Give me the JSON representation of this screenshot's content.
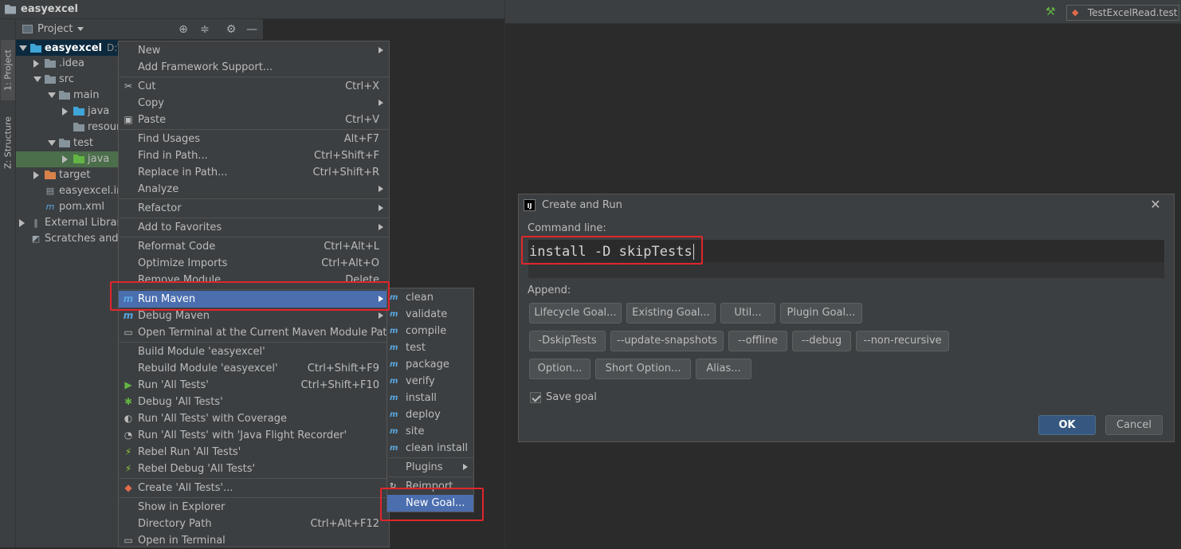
{
  "ide": {
    "project_name": "easyexcel",
    "left_tabs": [
      "1: Project",
      "Z: Structure"
    ],
    "project_dropdown": "Project",
    "tree": [
      {
        "label": "easyexcel",
        "suffix": "D:\\Id",
        "level": 0,
        "arrow": "down",
        "icon": "module"
      },
      {
        "label": ".idea",
        "level": 1,
        "arrow": "right",
        "icon": "folder-gray"
      },
      {
        "label": "src",
        "level": 1,
        "arrow": "down",
        "icon": "folder-gray"
      },
      {
        "label": "main",
        "level": 2,
        "arrow": "down",
        "icon": "folder-gray"
      },
      {
        "label": "java",
        "level": 3,
        "arrow": "right",
        "icon": "folder-blue"
      },
      {
        "label": "resour",
        "level": 3,
        "arrow": "none",
        "icon": "folder-resources"
      },
      {
        "label": "test",
        "level": 2,
        "arrow": "down",
        "icon": "folder-gray"
      },
      {
        "label": "java",
        "level": 3,
        "arrow": "right",
        "icon": "folder-green"
      },
      {
        "label": "target",
        "level": 1,
        "arrow": "right",
        "icon": "folder-orange"
      },
      {
        "label": "easyexcel.im",
        "level": 1,
        "arrow": "none",
        "icon": "iml-file"
      },
      {
        "label": "pom.xml",
        "level": 1,
        "arrow": "none",
        "icon": "maven-file"
      },
      {
        "label": "External Librari",
        "level": 0,
        "arrow": "right",
        "icon": "libraries"
      },
      {
        "label": "Scratches and C",
        "level": 0,
        "arrow": "none",
        "icon": "scratches"
      }
    ],
    "run_config": "TestExcelRead.test"
  },
  "context_menu": {
    "items": [
      {
        "label": "New",
        "shortcut": "",
        "submenu": true,
        "icon": ""
      },
      {
        "label": "Add Framework Support...",
        "shortcut": "",
        "submenu": false,
        "icon": ""
      },
      {
        "label": "Cut",
        "shortcut": "Ctrl+X",
        "submenu": false,
        "icon": "scissors"
      },
      {
        "label": "Copy",
        "shortcut": "",
        "submenu": true,
        "icon": ""
      },
      {
        "label": "Paste",
        "shortcut": "Ctrl+V",
        "submenu": false,
        "icon": "clipboard"
      },
      {
        "label": "Find Usages",
        "shortcut": "Alt+F7",
        "submenu": false,
        "icon": ""
      },
      {
        "label": "Find in Path...",
        "shortcut": "Ctrl+Shift+F",
        "submenu": false,
        "icon": ""
      },
      {
        "label": "Replace in Path...",
        "shortcut": "Ctrl+Shift+R",
        "submenu": false,
        "icon": ""
      },
      {
        "label": "Analyze",
        "shortcut": "",
        "submenu": true,
        "icon": ""
      },
      {
        "label": "Refactor",
        "shortcut": "",
        "submenu": true,
        "icon": ""
      },
      {
        "label": "Add to Favorites",
        "shortcut": "",
        "submenu": true,
        "icon": ""
      },
      {
        "label": "Reformat Code",
        "shortcut": "Ctrl+Alt+L",
        "submenu": false,
        "icon": ""
      },
      {
        "label": "Optimize Imports",
        "shortcut": "Ctrl+Alt+O",
        "submenu": false,
        "icon": ""
      },
      {
        "label": "Remove Module",
        "shortcut": "Delete",
        "submenu": false,
        "icon": ""
      },
      {
        "label": "Run Maven",
        "shortcut": "",
        "submenu": true,
        "icon": "maven",
        "highlighted": true
      },
      {
        "label": "Debug Maven",
        "shortcut": "",
        "submenu": true,
        "icon": "maven"
      },
      {
        "label": "Open Terminal at the Current Maven Module Path",
        "shortcut": "",
        "submenu": false,
        "icon": "terminal"
      },
      {
        "label": "Build Module 'easyexcel'",
        "shortcut": "",
        "submenu": false,
        "icon": ""
      },
      {
        "label": "Rebuild Module 'easyexcel'",
        "shortcut": "Ctrl+Shift+F9",
        "submenu": false,
        "icon": ""
      },
      {
        "label": "Run 'All Tests'",
        "shortcut": "Ctrl+Shift+F10",
        "submenu": false,
        "icon": "run"
      },
      {
        "label": "Debug 'All Tests'",
        "shortcut": "",
        "submenu": false,
        "icon": "debug"
      },
      {
        "label": "Run 'All Tests' with Coverage",
        "shortcut": "",
        "submenu": false,
        "icon": "coverage"
      },
      {
        "label": "Run 'All Tests' with 'Java Flight Recorder'",
        "shortcut": "",
        "submenu": false,
        "icon": "profiler"
      },
      {
        "label": "Rebel Run 'All Tests'",
        "shortcut": "",
        "submenu": false,
        "icon": "rebel"
      },
      {
        "label": "Rebel Debug 'All Tests'",
        "shortcut": "",
        "submenu": false,
        "icon": "rebel"
      },
      {
        "label": "Create 'All Tests'...",
        "shortcut": "",
        "submenu": false,
        "icon": "create"
      },
      {
        "label": "Show in Explorer",
        "shortcut": "",
        "submenu": false,
        "icon": ""
      },
      {
        "label": "Directory Path",
        "shortcut": "Ctrl+Alt+F12",
        "submenu": false,
        "icon": ""
      },
      {
        "label": "Open in Terminal",
        "shortcut": "",
        "submenu": false,
        "icon": "terminal"
      }
    ]
  },
  "maven_submenu": {
    "items": [
      {
        "label": "clean",
        "icon": "maven"
      },
      {
        "label": "validate",
        "icon": "maven"
      },
      {
        "label": "compile",
        "icon": "maven"
      },
      {
        "label": "test",
        "icon": "maven"
      },
      {
        "label": "package",
        "icon": "maven"
      },
      {
        "label": "verify",
        "icon": "maven"
      },
      {
        "label": "install",
        "icon": "maven"
      },
      {
        "label": "deploy",
        "icon": "maven"
      },
      {
        "label": "site",
        "icon": "maven"
      },
      {
        "label": "clean install",
        "icon": "maven"
      },
      {
        "label": "Plugins",
        "icon": "",
        "submenu": true
      },
      {
        "label": "Reimport",
        "icon": "refresh"
      },
      {
        "label": "New Goal...",
        "icon": "",
        "highlighted": true
      }
    ]
  },
  "dialog": {
    "title": "Create and Run",
    "command_label": "Command line:",
    "command_value": "install -D skipTests",
    "append_label": "Append:",
    "buttons_row1": [
      "Lifecycle Goal...",
      "Existing Goal...",
      "Util...",
      "Plugin Goal..."
    ],
    "buttons_row2": [
      "-DskipTests",
      "--update-snapshots",
      "--offline",
      "--debug",
      "--non-recursive"
    ],
    "buttons_row3": [
      "Option...",
      "Short Option...",
      "Alias..."
    ],
    "save_goal_label": "Save goal",
    "save_goal_checked": true,
    "ok_label": "OK",
    "cancel_label": "Cancel"
  },
  "colors": {
    "highlight": "#4b6eaf",
    "annotation_red": "#e0262b",
    "ok_button": "#365880"
  }
}
